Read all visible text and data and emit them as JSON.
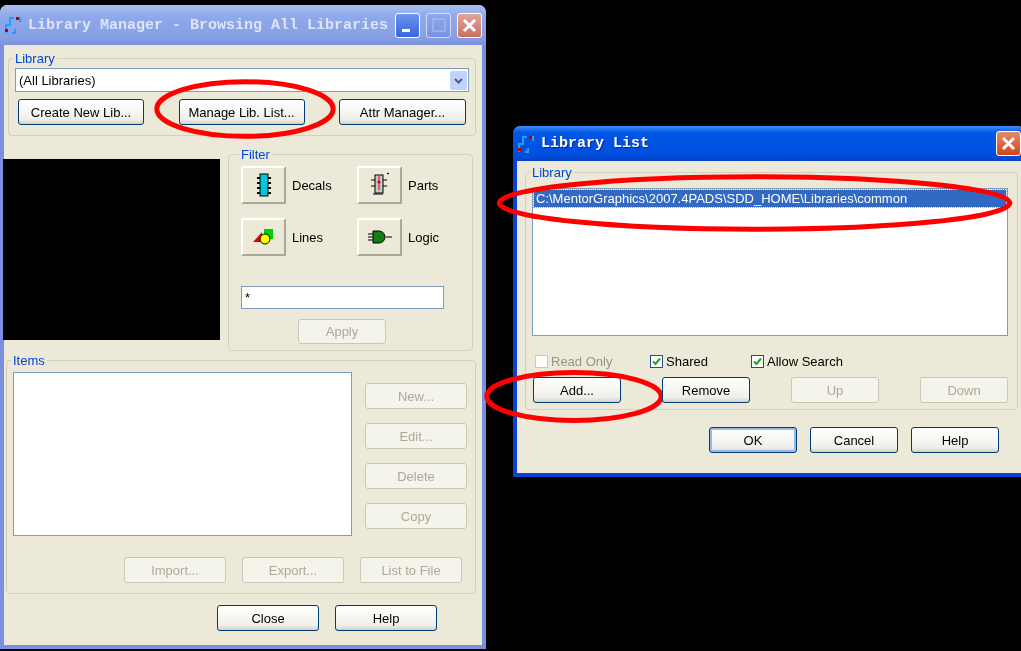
{
  "library_manager": {
    "title": "Library Manager - Browsing All Libraries",
    "active": false,
    "library_group": {
      "label": "Library",
      "combo_value": "(All Libraries)",
      "buttons": [
        {
          "label": "Create New Lib...",
          "circled": false
        },
        {
          "label": "Manage Lib. List...",
          "circled": true
        },
        {
          "label": "Attr Manager...",
          "circled": false
        }
      ]
    },
    "filter_group": {
      "label": "Filter",
      "types": [
        {
          "label": "Decals",
          "kind": "decals"
        },
        {
          "label": "Parts",
          "kind": "parts"
        },
        {
          "label": "Lines",
          "kind": "lines"
        },
        {
          "label": "Logic",
          "kind": "logic"
        }
      ],
      "pattern": "*",
      "apply": {
        "label": "Apply",
        "disabled": true
      }
    },
    "items_group": {
      "label": "Items",
      "side_buttons": [
        {
          "label": "New...",
          "disabled": true
        },
        {
          "label": "Edit...",
          "disabled": true
        },
        {
          "label": "Delete",
          "disabled": true
        },
        {
          "label": "Copy",
          "disabled": true
        }
      ],
      "bottom_buttons": [
        {
          "label": "Import...",
          "disabled": true
        },
        {
          "label": "Export...",
          "disabled": true
        },
        {
          "label": "List to File",
          "disabled": true
        }
      ]
    },
    "buttons": [
      {
        "label": "Close",
        "disabled": false
      },
      {
        "label": "Help",
        "disabled": false
      }
    ]
  },
  "library_list": {
    "title": "Library List",
    "active": true,
    "group_label": "Library",
    "rows": [
      {
        "path": "C:\\MentorGraphics\\2007.4PADS\\SDD_HOME\\Libraries\\common",
        "selected": true,
        "circled": true
      }
    ],
    "options": [
      {
        "label": "Read Only",
        "checked": false,
        "disabled": true
      },
      {
        "label": "Shared",
        "checked": true,
        "disabled": false
      },
      {
        "label": "Allow Search",
        "checked": true,
        "disabled": false
      }
    ],
    "buttons": [
      {
        "label": "Add...",
        "disabled": false,
        "circled": true
      },
      {
        "label": "Remove",
        "disabled": false,
        "circled": false
      },
      {
        "label": "Up",
        "disabled": true,
        "circled": false
      },
      {
        "label": "Down",
        "disabled": true,
        "circled": false
      }
    ],
    "dialog_buttons": [
      {
        "label": "OK",
        "default": true
      },
      {
        "label": "Cancel",
        "default": false
      },
      {
        "label": "Help",
        "default": false
      }
    ]
  }
}
